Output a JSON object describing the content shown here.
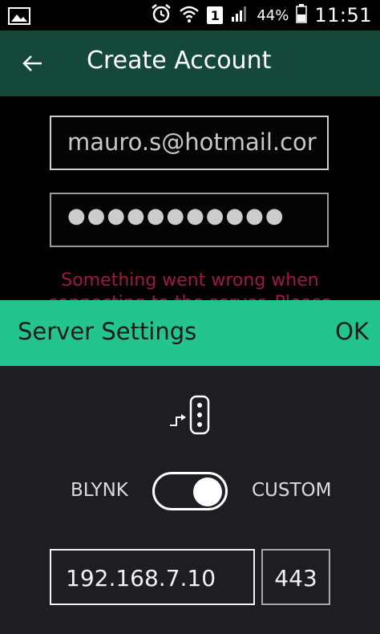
{
  "status_bar": {
    "battery": "44%",
    "sim_slot": "1",
    "time": "11:51"
  },
  "appbar": {
    "title": "Create Account"
  },
  "form": {
    "email_value": "mauro.s@hotmail.cor",
    "password_value": "●●●●●●●●●●●",
    "error_line1": "Something went wrong when",
    "error_line2": "connecting to the server. Please"
  },
  "server_settings": {
    "title": "Server Settings",
    "ok_label": "OK",
    "toggle_left_label": "BLYNK",
    "toggle_right_label": "CUSTOM",
    "toggle_state": "custom",
    "host_value": "192.168.7.10",
    "port_value": "443"
  },
  "colors": {
    "appbar_bg": "#14493a",
    "sheet_header_bg": "#24c48e",
    "sheet_body_bg": "#1e1e22",
    "error_text": "#a01845"
  },
  "icons": [
    "image-icon",
    "alarm-icon",
    "wifi-icon",
    "signal-icon",
    "battery-icon",
    "back-arrow-icon",
    "server-icon"
  ]
}
